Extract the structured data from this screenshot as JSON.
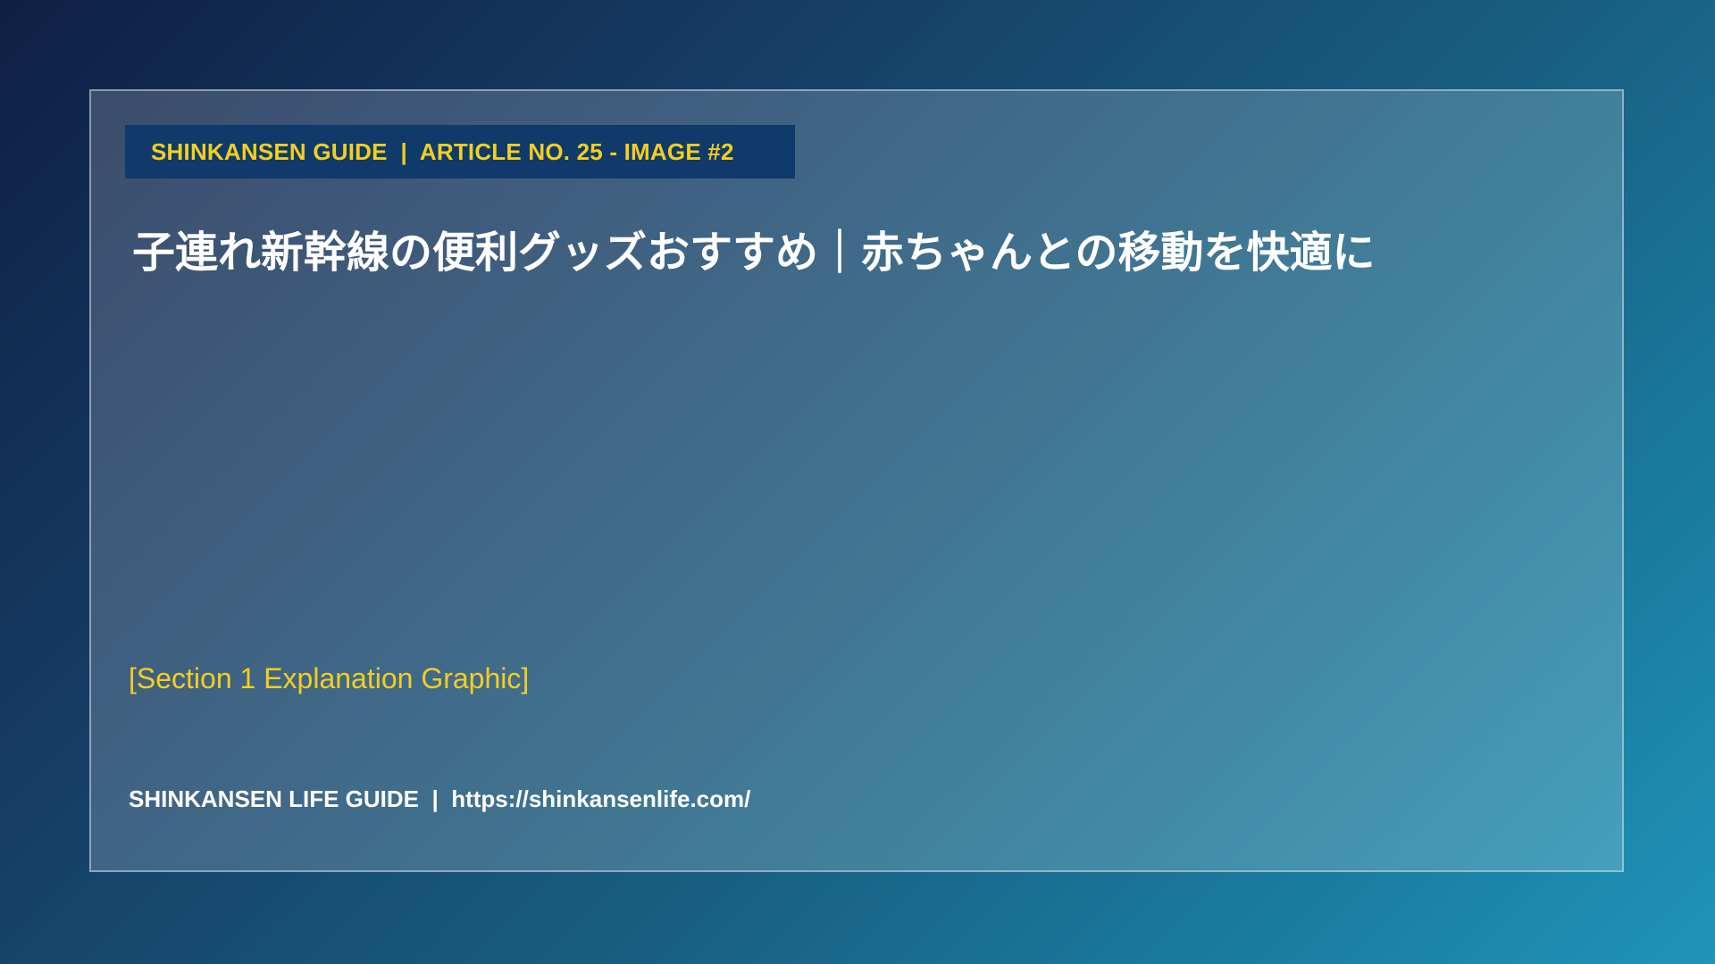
{
  "header": {
    "tag": "SHINKANSEN GUIDE  |  ARTICLE NO. 25 - IMAGE #2"
  },
  "main": {
    "title": "子連れ新幹線の便利グッズおすすめ｜赤ちゃんとの移動を快適に",
    "section_label": "[Section 1 Explanation Graphic]"
  },
  "footer": {
    "text": "SHINKANSEN LIFE GUIDE  |  https://shinkansenlife.com/"
  },
  "colors": {
    "accent": "#f3cf1e",
    "tag_background": "#0f3a6a",
    "title": "#ffffff"
  }
}
